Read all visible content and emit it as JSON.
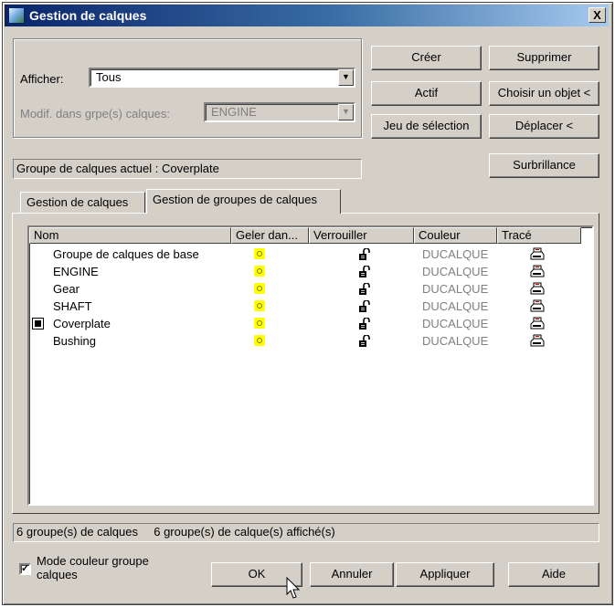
{
  "window": {
    "title": "Gestion de calques",
    "close_label": "X"
  },
  "filters": {
    "afficher_label": "Afficher:",
    "afficher_value": "Tous",
    "modif_label": "Modif. dans grpe(s) calques:",
    "modif_value": "ENGINE"
  },
  "buttons": {
    "creer": "Créer",
    "supprimer": "Supprimer",
    "actif": "Actif",
    "choisir": "Choisir un objet <",
    "jeu": "Jeu de sélection",
    "deplacer": "Déplacer <",
    "surbrillance": "Surbrillance"
  },
  "current_group": "Groupe de calques actuel : Coverplate",
  "tabs": [
    "Gestion de calques",
    "Gestion de groupes de calques"
  ],
  "table": {
    "columns": [
      "Nom",
      "Geler dan...",
      "Verrouiller",
      "Couleur",
      "Tracé"
    ],
    "rows": [
      {
        "name": "Groupe de calques de base",
        "couleur": "DUCALQUE",
        "current": false
      },
      {
        "name": "ENGINE",
        "couleur": "DUCALQUE",
        "current": false
      },
      {
        "name": "Gear",
        "couleur": "DUCALQUE",
        "current": false
      },
      {
        "name": "SHAFT",
        "couleur": "DUCALQUE",
        "current": false
      },
      {
        "name": "Coverplate",
        "couleur": "DUCALQUE",
        "current": true
      },
      {
        "name": "Bushing",
        "couleur": "DUCALQUE",
        "current": false
      }
    ]
  },
  "status": {
    "groups_count": "6 groupe(s) de calques",
    "groups_shown": "6 groupe(s) de calque(s) affiché(s)"
  },
  "footer": {
    "mode_couleur_label": "Mode couleur groupe calques",
    "mode_couleur_checked": true,
    "ok": "OK",
    "annuler": "Annuler",
    "appliquer": "Appliquer",
    "aide": "Aide"
  },
  "icons": {
    "freeze": "sun-icon",
    "lock": "unlocked-padlock-icon",
    "plot": "printer-icon",
    "current": "current-layer-marker-icon"
  },
  "colors": {
    "title_start": "#0a246a",
    "title_end": "#a6caf0",
    "dialog_bg": "#d4d0c8",
    "freeze_icon": "#ffff00"
  }
}
